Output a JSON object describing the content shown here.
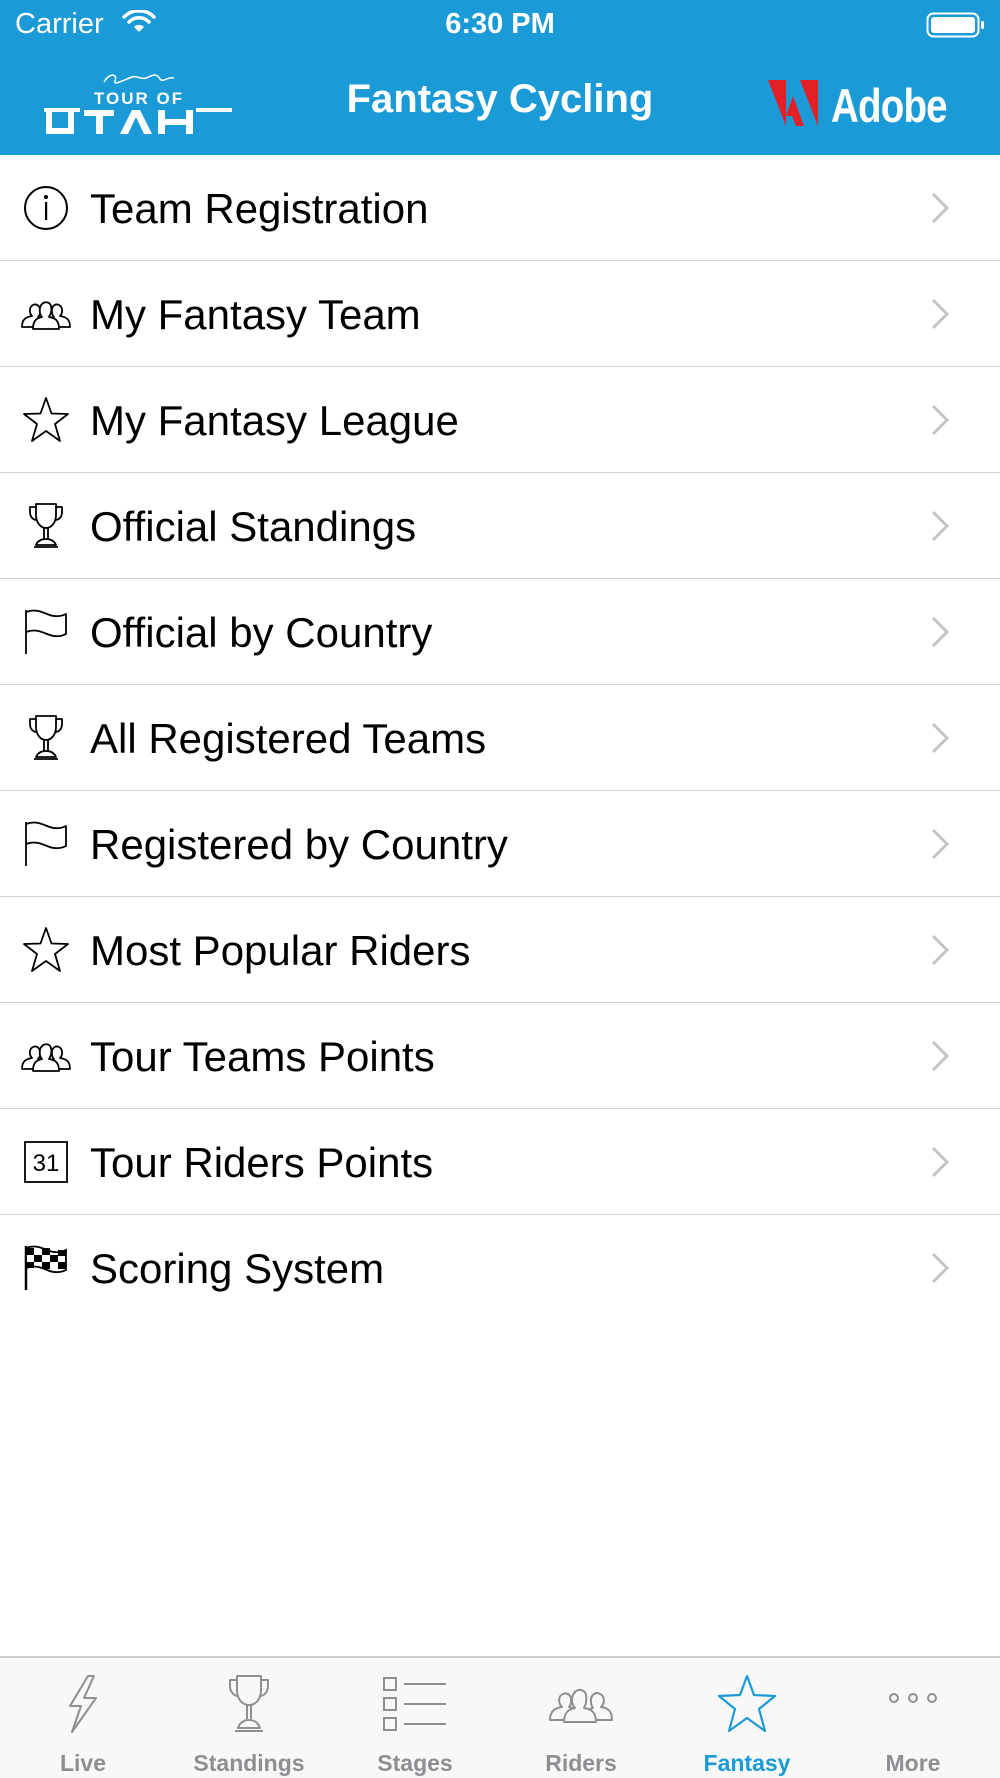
{
  "status_bar": {
    "carrier": "Carrier",
    "time": "6:30 PM"
  },
  "header": {
    "title": "Fantasy Cycling",
    "left_logo": "Tour of Utah",
    "right_logo": "Adobe"
  },
  "colors": {
    "brand_blue": "#1a9ad6",
    "adobe_red": "#e41f26",
    "tab_inactive": "#8e8e93"
  },
  "menu": [
    {
      "label": "Team Registration",
      "icon": "info-icon"
    },
    {
      "label": "My Fantasy Team",
      "icon": "team-icon"
    },
    {
      "label": "My Fantasy League",
      "icon": "star-icon"
    },
    {
      "label": "Official Standings",
      "icon": "trophy-icon"
    },
    {
      "label": "Official by Country",
      "icon": "flag-icon"
    },
    {
      "label": "All Registered Teams",
      "icon": "trophy-icon"
    },
    {
      "label": "Registered by Country",
      "icon": "flag-icon"
    },
    {
      "label": "Most Popular Riders",
      "icon": "star-icon"
    },
    {
      "label": "Tour Teams Points",
      "icon": "team-icon"
    },
    {
      "label": "Tour Riders Points",
      "icon": "calendar-icon",
      "icon_text": "31"
    },
    {
      "label": "Scoring System",
      "icon": "checkered-flag-icon"
    }
  ],
  "tabbar": {
    "tabs": [
      {
        "label": "Live",
        "icon": "lightning-icon",
        "active": false
      },
      {
        "label": "Standings",
        "icon": "trophy-icon",
        "active": false
      },
      {
        "label": "Stages",
        "icon": "list-icon",
        "active": false
      },
      {
        "label": "Riders",
        "icon": "team-icon",
        "active": false
      },
      {
        "label": "Fantasy",
        "icon": "star-icon",
        "active": true
      },
      {
        "label": "More",
        "icon": "ellipsis-icon",
        "active": false
      }
    ]
  }
}
